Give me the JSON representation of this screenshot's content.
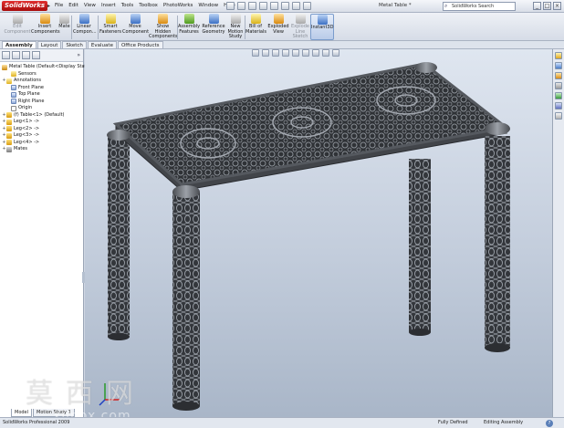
{
  "app": {
    "logo_text": "SolidWorks",
    "document_title": "Metal Table *",
    "menu": [
      "File",
      "Edit",
      "View",
      "Insert",
      "Tools",
      "Toolbox",
      "PhotoWorks",
      "Window",
      "Help"
    ],
    "search_placeholder": "SolidWorks Search",
    "window_controls": [
      "_",
      "□",
      "×"
    ]
  },
  "command_manager": {
    "items": [
      {
        "label": "Edit\nComponent",
        "icon": "edit-component-icon",
        "enabled": false
      },
      {
        "label": "Insert\nComponents",
        "icon": "insert-components-icon",
        "enabled": true
      },
      {
        "label": "Mate",
        "icon": "mate-icon",
        "enabled": true
      },
      {
        "label": "Linear\nCompon...",
        "icon": "linear-pattern-icon",
        "enabled": true
      },
      {
        "label": "Smart\nFasteners",
        "icon": "smart-fasteners-icon",
        "enabled": true
      },
      {
        "label": "Move\nComponent",
        "icon": "move-component-icon",
        "enabled": true
      },
      {
        "label": "Show\nHidden\nComponents",
        "icon": "show-hidden-icon",
        "enabled": true
      },
      {
        "label": "Assembly\nFeatures",
        "icon": "assembly-features-icon",
        "enabled": true
      },
      {
        "label": "Reference\nGeometry",
        "icon": "reference-geometry-icon",
        "enabled": true
      },
      {
        "label": "New\nMotion\nStudy",
        "icon": "motion-study-icon",
        "enabled": true
      },
      {
        "label": "Bill of\nMaterials",
        "icon": "bom-icon",
        "enabled": true
      },
      {
        "label": "Exploded\nView",
        "icon": "exploded-view-icon",
        "enabled": true
      },
      {
        "label": "Explode\nLine\nSketch",
        "icon": "explode-line-icon",
        "enabled": false
      },
      {
        "label": "Instant3D",
        "icon": "instant3d-icon",
        "enabled": true,
        "active": true
      }
    ]
  },
  "tabs": [
    {
      "label": "Assembly",
      "active": true
    },
    {
      "label": "Layout",
      "active": false
    },
    {
      "label": "Sketch",
      "active": false
    },
    {
      "label": "Evaluate",
      "active": false
    },
    {
      "label": "Office Products",
      "active": false
    }
  ],
  "feature_tree": [
    {
      "label": "Metal Table  (Default<Display State",
      "icon": "assembly-icon",
      "expander": "",
      "indent": 0
    },
    {
      "label": "Sensors",
      "icon": "sensors-icon",
      "expander": "",
      "indent": 1
    },
    {
      "label": "Annotations",
      "icon": "annotations-icon",
      "expander": "+",
      "indent": 0
    },
    {
      "label": "Front Plane",
      "icon": "plane-icon",
      "expander": "",
      "indent": 1
    },
    {
      "label": "Top Plane",
      "icon": "plane-icon",
      "expander": "",
      "indent": 1
    },
    {
      "label": "Right Plane",
      "icon": "plane-icon",
      "expander": "",
      "indent": 1
    },
    {
      "label": "Origin",
      "icon": "origin-icon",
      "expander": "",
      "indent": 1
    },
    {
      "label": "(f) Table<1> (Default)",
      "icon": "part-icon",
      "expander": "+",
      "indent": 0
    },
    {
      "label": "Leg<1> ->",
      "icon": "part-icon",
      "expander": "+",
      "indent": 0
    },
    {
      "label": "Leg<2> ->",
      "icon": "part-icon",
      "expander": "+",
      "indent": 0
    },
    {
      "label": "Leg<3> ->",
      "icon": "part-icon",
      "expander": "+",
      "indent": 0
    },
    {
      "label": "Leg<4> ->",
      "icon": "part-icon",
      "expander": "+",
      "indent": 0
    },
    {
      "label": "Mates",
      "icon": "mates-icon",
      "expander": "+",
      "indent": 0
    }
  ],
  "bottom_tabs": [
    {
      "label": "Model",
      "active": true
    },
    {
      "label": "Motion Study 1",
      "active": false
    }
  ],
  "status": {
    "left": "SolidWorks Professional 2009",
    "definition": "Fully Defined",
    "mode": "Editing Assembly",
    "help": "?"
  },
  "watermark": {
    "text": "莫西网",
    "url": "ximox.com"
  },
  "colors": {
    "accent": "#3a6fc4",
    "logo_red": "#c81818",
    "metal": "#4a4d52"
  }
}
